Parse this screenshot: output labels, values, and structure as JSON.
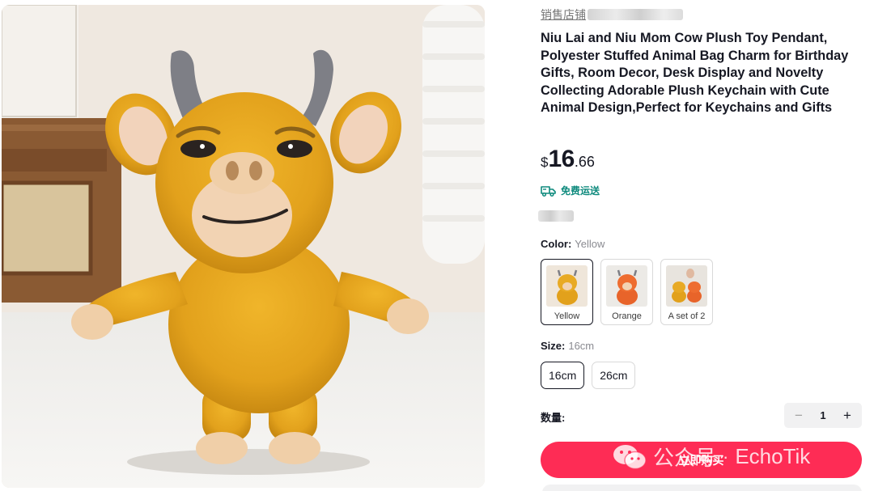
{
  "store": {
    "label": "销售店铺"
  },
  "product": {
    "title": "Niu Lai and Niu Mom Cow Plush Toy Pendant, Polyester Stuffed Animal Bag Charm for Birthday Gifts, Room Decor, Desk Display and Novelty Collecting Adorable Plush Keychain with Cute Animal Design,Perfect for Keychains and Gifts",
    "image_icon": "yellow-cow-plush-photo"
  },
  "price": {
    "currency": "$",
    "integer": "16",
    "decimal": ".66"
  },
  "shipping": {
    "label": "免费运送",
    "icon": "truck-icon",
    "color": "#0e8a7d"
  },
  "color": {
    "label": "Color:",
    "selected": "Yellow",
    "options": [
      {
        "label": "Yellow"
      },
      {
        "label": "Orange"
      },
      {
        "label": "A set of 2"
      }
    ]
  },
  "size": {
    "label": "Size:",
    "selected": "16cm",
    "options": [
      {
        "label": "16cm"
      },
      {
        "label": "26cm"
      }
    ]
  },
  "quantity": {
    "label": "数量:",
    "value": "1",
    "minus": "−",
    "plus": "+"
  },
  "buy_button": {
    "label": "立即购买",
    "color": "#fe2c55"
  },
  "watermark": {
    "text": "公众号",
    "separator": "·",
    "brand": "EchoTik"
  }
}
